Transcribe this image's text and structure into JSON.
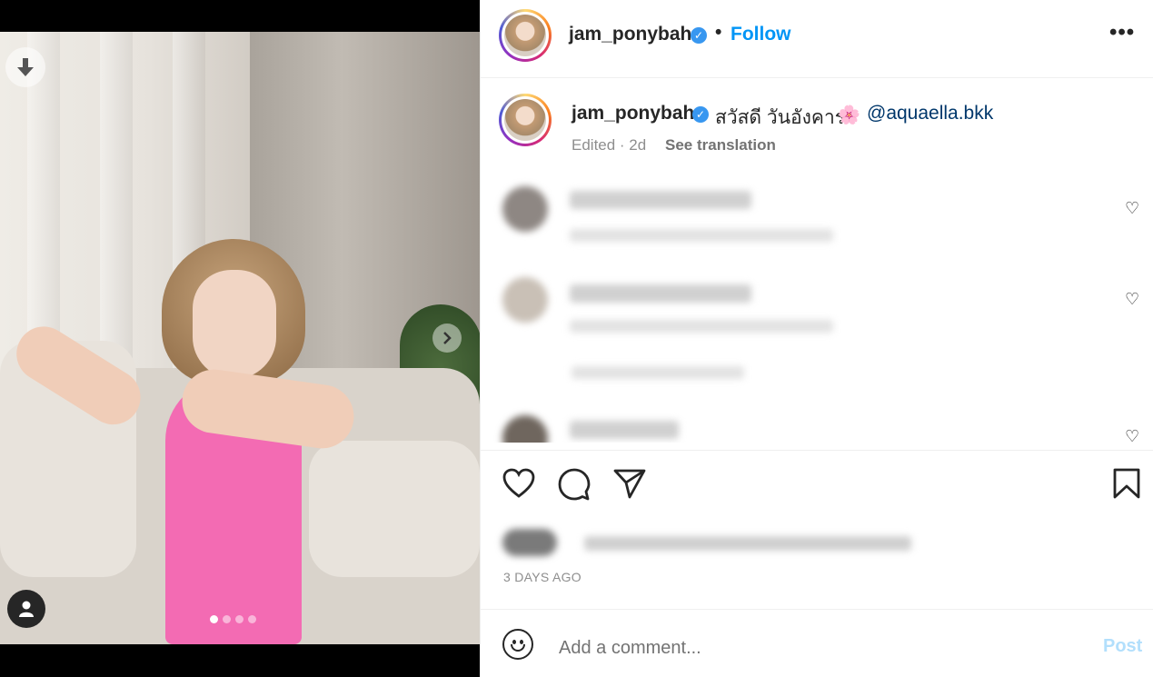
{
  "post": {
    "username": "jam_ponybah",
    "verified_icon": "verified-badge-icon",
    "separator": "•",
    "follow_label": "Follow",
    "more_label": "•••"
  },
  "caption": {
    "username": "jam_ponybah",
    "text": "สวัสดี วันอังคาร",
    "emoji": "🌸",
    "mention": "@aquaella.bkk",
    "meta": "Edited · 2d",
    "see_translation": "See translation"
  },
  "comments": [
    {
      "user": "blurred",
      "text": "blurred",
      "meta": "blurred"
    },
    {
      "user": "blurred",
      "text": "blurred",
      "meta": "blurred",
      "view_replies": "blurred"
    },
    {
      "user": "blurred",
      "text": "blurred"
    }
  ],
  "likes_text": "blurred",
  "posted_time": "3 DAYS AGO",
  "comment_box": {
    "placeholder": "Add a comment...",
    "post_label": "Post"
  },
  "colors": {
    "accent": "#0095f6",
    "mention": "#00376b",
    "post_disabled": "#b2dffc",
    "swimsuit": "#f36bb3"
  },
  "media": {
    "slide_count": 4,
    "active_slide": 1
  }
}
